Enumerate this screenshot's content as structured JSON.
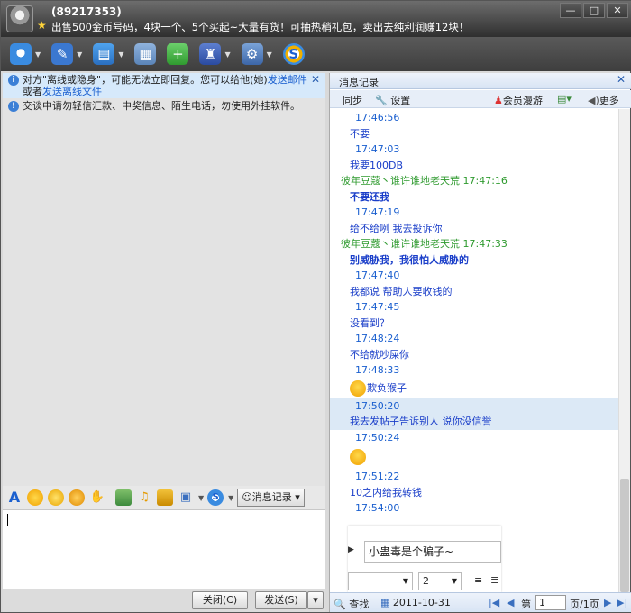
{
  "title_bar": {
    "qq_number": "(89217353)",
    "signature": "出售500金币号码，4块一个、5个买起~大量有货！可抽热稍礼包，卖出去纯利润赚12块！",
    "buttons": [
      "—",
      "□",
      "✕"
    ]
  },
  "toolbar": {
    "icons": [
      "video-call-icon",
      "voice-call-icon",
      "send-file-icon",
      "screenshot-icon",
      "create-group-icon",
      "app-icon",
      "settings-icon",
      "money-icon"
    ]
  },
  "left_pane": {
    "notice": {
      "prefix": "对方\"离线或隐身\"，可能无法立即回复。您可以给他(她)",
      "link1": "发送邮件",
      "middle": "或者",
      "link2": "发送离线文件",
      "close": "✕"
    },
    "tip": "交谈中请勿轻信汇款、中奖信息、陌生电话，勿使用外挂软件。",
    "input_toolbar": {
      "font_label": "A",
      "history_button": "消息记录"
    },
    "buttons": {
      "close": "关闭(C)",
      "send": "发送(S)"
    }
  },
  "right_pane": {
    "title": "消息记录",
    "close": "✕",
    "tools": {
      "sync": "同步",
      "settings": "设置",
      "vip": "会员漫游",
      "more": "更多"
    },
    "messages": [
      {
        "type": "time",
        "text": "17:46:56"
      },
      {
        "type": "text",
        "text": "不要"
      },
      {
        "type": "time",
        "text": "17:47:03"
      },
      {
        "type": "text",
        "text": "我要100DB"
      },
      {
        "type": "sender",
        "text": "彼年豆蔻丶谁许谁地老天荒 17:47:16"
      },
      {
        "type": "text-bold",
        "text": "不要还我"
      },
      {
        "type": "time",
        "text": "17:47:19"
      },
      {
        "type": "text",
        "text": "给不给咧   我去投诉你"
      },
      {
        "type": "sender",
        "text": "彼年豆蔻丶谁许谁地老天荒 17:47:33"
      },
      {
        "type": "text-bold",
        "text": "别威胁我，我很怕人威胁的"
      },
      {
        "type": "time",
        "text": "17:47:40"
      },
      {
        "type": "text",
        "text": "我都说   帮助人要收钱的"
      },
      {
        "type": "time",
        "text": "17:47:45"
      },
      {
        "type": "text",
        "text": "没看到？"
      },
      {
        "type": "time",
        "text": "17:48:24"
      },
      {
        "type": "text",
        "text": "不给就吵屎你"
      },
      {
        "type": "time",
        "text": "17:48:33"
      },
      {
        "type": "emoji-text",
        "text": "欺负猴子"
      },
      {
        "type": "time-hl",
        "text": "17:50:20"
      },
      {
        "type": "text-hl",
        "text": "我去发帖子告诉别人   说你没信誉"
      },
      {
        "type": "time",
        "text": "17:50:24"
      },
      {
        "type": "emoji",
        "text": ""
      },
      {
        "type": "time",
        "text": "17:51:22"
      },
      {
        "type": "text",
        "text": "10之内给我转钱"
      },
      {
        "type": "time",
        "text": "17:54:00"
      }
    ],
    "popup": {
      "field": "小蛊毒是个骗子~",
      "font_select": "",
      "size_select": "2"
    },
    "footer": {
      "search": "查找",
      "date": "2011-10-31",
      "page_prefix": "第",
      "page_value": "1",
      "page_suffix": "页/1页"
    }
  }
}
